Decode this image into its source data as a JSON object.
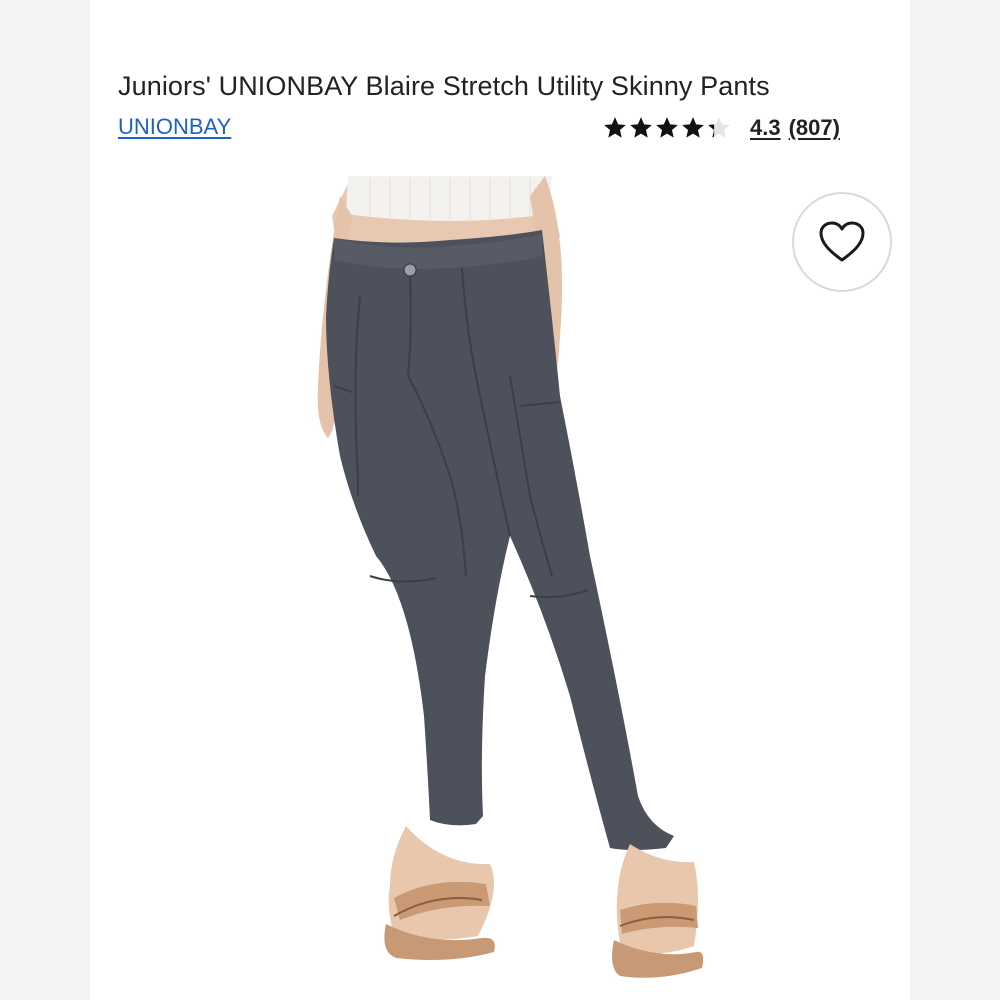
{
  "product": {
    "title": "Juniors' UNIONBAY Blaire Stretch Utility Skinny Pants",
    "brand_link": "UNIONBAY",
    "rating": {
      "value": 4.3,
      "value_label": "4.3",
      "count_label": "(807)",
      "max_stars": 5
    }
  },
  "image": {
    "description_icon": "product-photo"
  },
  "actions": {
    "favorite_icon": "heart-outline-icon"
  },
  "colors": {
    "link": "#1f62c6",
    "text": "#222222",
    "pants": "#4a4f58"
  }
}
